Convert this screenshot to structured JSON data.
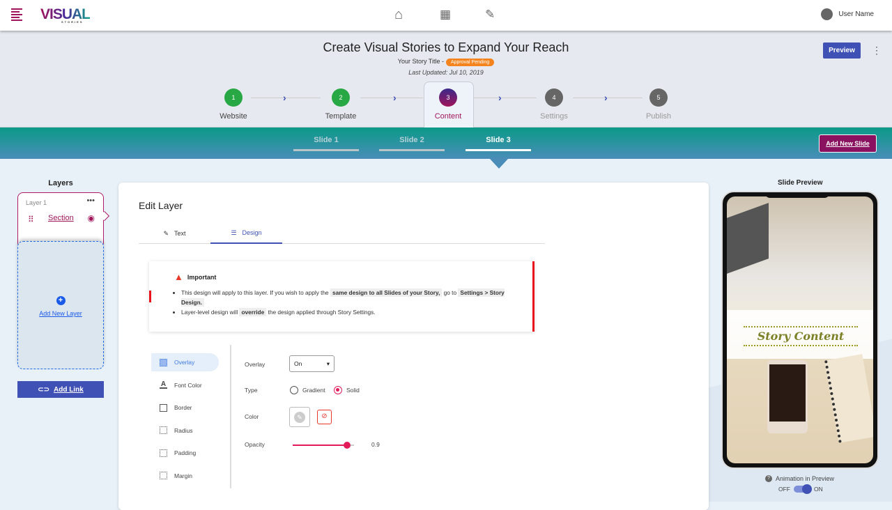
{
  "header": {
    "logo": "VISUAL",
    "logo_sub": "STORIES",
    "nav": [
      "home-icon",
      "dashboard-icon",
      "edit-icon"
    ],
    "user": "User Name"
  },
  "story": {
    "heading": "Create Visual Stories to Expand Your Reach",
    "title_label": "Your Story Title -",
    "status": "Approval Pending",
    "updated": "Last Updated: Jul 10, 2019",
    "preview": "Preview"
  },
  "steps": [
    {
      "n": "1",
      "label": "Website"
    },
    {
      "n": "2",
      "label": "Template"
    },
    {
      "n": "3",
      "label": "Content"
    },
    {
      "n": "4",
      "label": "Settings"
    },
    {
      "n": "5",
      "label": "Publish"
    }
  ],
  "slides": {
    "tabs": [
      "Slide 1",
      "Slide 2",
      "Slide 3"
    ],
    "active": 2,
    "add": "Add New Slide"
  },
  "layers": {
    "heading": "Layers",
    "layer_name": "Layer 1",
    "section": "Section",
    "add_layer": "Add New Layer",
    "add_link": "Add Link"
  },
  "edit": {
    "title": "Edit Layer",
    "tabs": [
      "Text",
      "Design"
    ],
    "active_tab": 1,
    "important": {
      "title": "Important",
      "l1a": "This design will apply to this layer. If you wish to apply the",
      "l1b": "same design to all Slides of your Story,",
      "l1c": "go to",
      "l1d": "Settings > Story Design.",
      "l2a": "Layer-level design will",
      "l2b": "override",
      "l2c": "the design applied through Story Settings."
    },
    "menu": [
      "Overlay",
      "Font Color",
      "Border",
      "Radius",
      "Padding",
      "Margin"
    ],
    "fields": {
      "overlay_label": "Overlay",
      "overlay_value": "On",
      "type_label": "Type",
      "type_options": [
        "Gradient",
        "Solid"
      ],
      "type_selected": "Solid",
      "color_label": "Color",
      "opacity_label": "Opacity",
      "opacity": "0.9"
    }
  },
  "preview": {
    "heading": "Slide Preview",
    "story_text": "Story Content",
    "animation_label": "Animation in Preview",
    "off": "OFF",
    "on": "ON",
    "animation_on": true
  },
  "colors": {
    "accent": "#3f51b5",
    "magenta": "#a0145a",
    "done": "#28a745",
    "pending": "#f5841f"
  }
}
